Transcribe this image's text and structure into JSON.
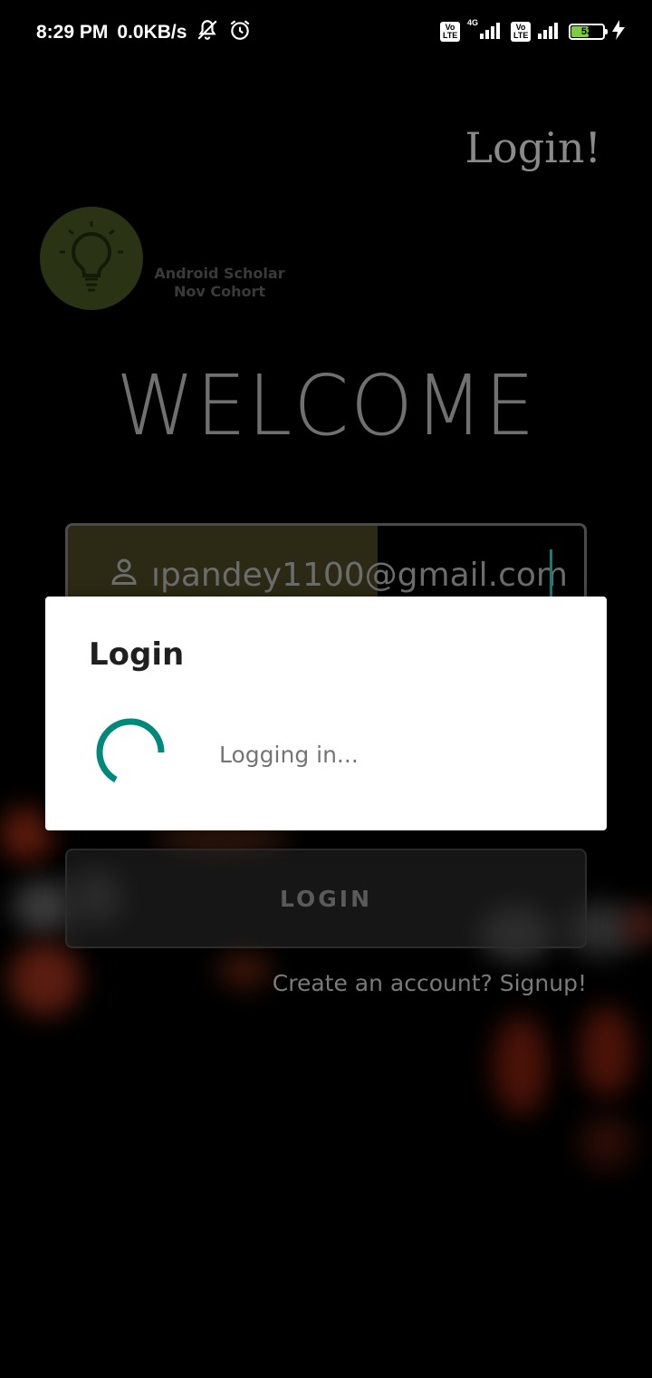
{
  "status_bar": {
    "time": "8:29 PM",
    "network_speed": "0.0KB/s",
    "volte_label": "Vo LTE",
    "network_type": "4G",
    "battery_level": "53",
    "icons": [
      "mute-icon",
      "alarm-icon",
      "signal-icon",
      "battery-icon",
      "charging-icon"
    ]
  },
  "header": {
    "title": "Login!"
  },
  "logo": {
    "line1": "Android Scholar",
    "line2": "Nov Cohort",
    "icon": "lightbulb-icon"
  },
  "welcome": "WELCOME",
  "email_field": {
    "value": "ıpandey1100@gmail.com",
    "icon": "user-icon"
  },
  "login_button": {
    "label": "LOGIN"
  },
  "signup_link": "Create an account? Signup!",
  "dialog": {
    "title": "Login",
    "message": "Logging in...",
    "spinner_color": "#00897B"
  },
  "colors": {
    "accent": "#00897B",
    "battery": "#7ccf3b"
  }
}
